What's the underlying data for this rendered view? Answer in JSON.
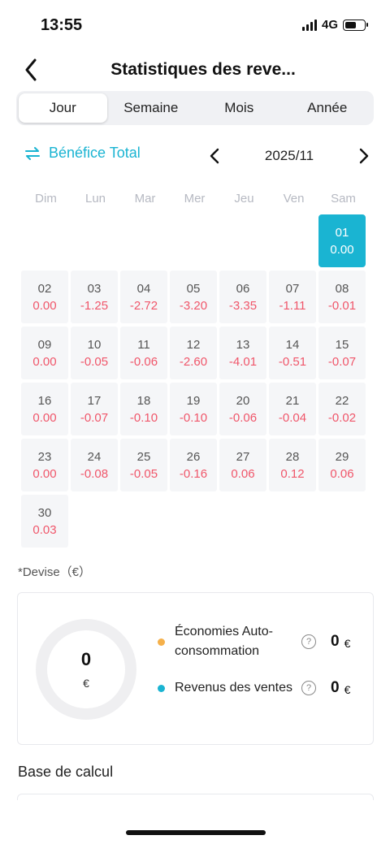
{
  "status": {
    "time": "13:55",
    "network": "4G"
  },
  "header": {
    "title": "Statistiques des reve..."
  },
  "tabs": [
    {
      "label": "Jour",
      "active": true
    },
    {
      "label": "Semaine",
      "active": false
    },
    {
      "label": "Mois",
      "active": false
    },
    {
      "label": "Année",
      "active": false
    }
  ],
  "toolbar": {
    "metric_label": "Bénéfice Total",
    "month": "2025/11",
    "accent": "#1ab4d2"
  },
  "weekdays": [
    "Dim",
    "Lun",
    "Mar",
    "Mer",
    "Jeu",
    "Ven",
    "Sam"
  ],
  "calendar": {
    "leading_empty": 6,
    "selected": "01",
    "days": [
      {
        "day": "01",
        "value": "0.00"
      },
      {
        "day": "02",
        "value": "0.00"
      },
      {
        "day": "03",
        "value": "-1.25"
      },
      {
        "day": "04",
        "value": "-2.72"
      },
      {
        "day": "05",
        "value": "-3.20"
      },
      {
        "day": "06",
        "value": "-3.35"
      },
      {
        "day": "07",
        "value": "-1.11"
      },
      {
        "day": "08",
        "value": "-0.01"
      },
      {
        "day": "09",
        "value": "0.00"
      },
      {
        "day": "10",
        "value": "-0.05"
      },
      {
        "day": "11",
        "value": "-0.06"
      },
      {
        "day": "12",
        "value": "-2.60"
      },
      {
        "day": "13",
        "value": "-4.01"
      },
      {
        "day": "14",
        "value": "-0.51"
      },
      {
        "day": "15",
        "value": "-0.07"
      },
      {
        "day": "16",
        "value": "0.00"
      },
      {
        "day": "17",
        "value": "-0.07"
      },
      {
        "day": "18",
        "value": "-0.10"
      },
      {
        "day": "19",
        "value": "-0.10"
      },
      {
        "day": "20",
        "value": "-0.06"
      },
      {
        "day": "21",
        "value": "-0.04"
      },
      {
        "day": "22",
        "value": "-0.02"
      },
      {
        "day": "23",
        "value": "0.00"
      },
      {
        "day": "24",
        "value": "-0.08"
      },
      {
        "day": "25",
        "value": "-0.05"
      },
      {
        "day": "26",
        "value": "-0.16"
      },
      {
        "day": "27",
        "value": "0.06"
      },
      {
        "day": "28",
        "value": "0.12"
      },
      {
        "day": "29",
        "value": "0.06"
      },
      {
        "day": "30",
        "value": "0.03"
      }
    ]
  },
  "currency_note": "*Devise（€）",
  "summary": {
    "total_value": "0",
    "total_unit": "€",
    "items": [
      {
        "label": "Économies Auto-consommation",
        "help": "?",
        "amount": "0",
        "unit": "€",
        "color": "#f5b04a"
      },
      {
        "label": "Revenus des ventes",
        "help": "?",
        "amount": "0",
        "unit": "€",
        "color": "#1ab4d2"
      }
    ]
  },
  "calc_section": {
    "title": "Base de calcul"
  }
}
